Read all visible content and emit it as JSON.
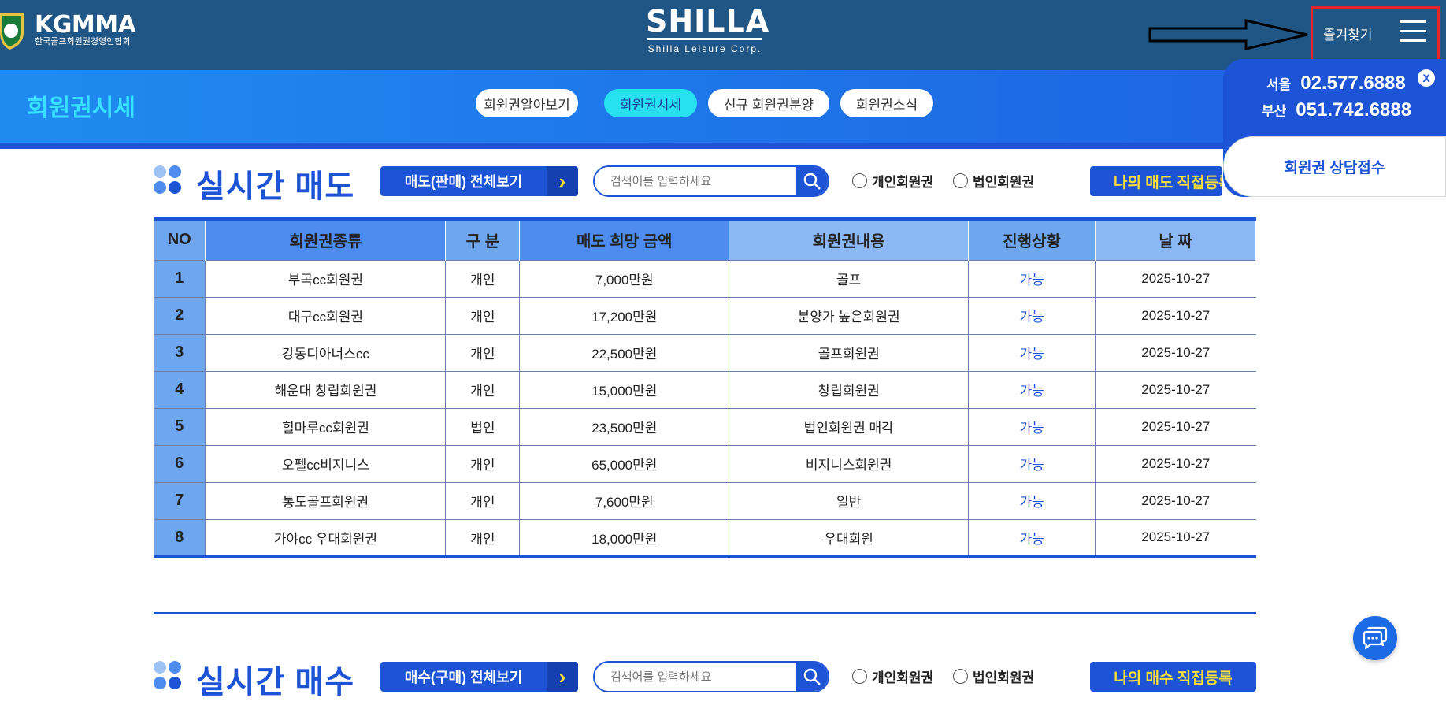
{
  "header": {
    "kgmma_logo_text": "KGMMA",
    "kgmma_logo_sub": "한국골프회원권경영인협회",
    "brand_name": "SHILLA",
    "brand_sub": "Shilla Leisure Corp.",
    "favorites_label": "즐겨찾기"
  },
  "subnav": {
    "title": "회원권시세",
    "tabs": [
      {
        "label": "회원권알아보기",
        "active": false
      },
      {
        "label": "회원권시세",
        "active": true
      },
      {
        "label": "신규 회원권분양",
        "active": false
      },
      {
        "label": "회원권소식",
        "active": false
      }
    ]
  },
  "contact": {
    "close_label": "X",
    "seoul_label": "서울",
    "seoul_phone": "02.577.6888",
    "busan_label": "부산",
    "busan_phone": "051.742.6888",
    "consult_label": "회원권 상담접수"
  },
  "sell_section": {
    "title": "실시간 매도",
    "view_all_label": "매도(판매) 전체보기",
    "search_placeholder": "검색어를 입력하세요",
    "radio_personal": "개인회원권",
    "radio_corporate": "법인회원권",
    "register_label": "나의 매도 직접등록"
  },
  "buy_section": {
    "title": "실시간 매수",
    "view_all_label": "매수(구매) 전체보기",
    "search_placeholder": "검색어를 입력하세요",
    "radio_personal": "개인회원권",
    "radio_corporate": "법인회원권",
    "register_label": "나의 매수 직접등록"
  },
  "table": {
    "headers": [
      "NO",
      "회원권종류",
      "구 분",
      "매도 희망 금액",
      "회원권내용",
      "진행상황",
      "날 짜"
    ],
    "rows": [
      [
        "1",
        "부곡cc회원권",
        "개인",
        "7,000만원",
        "골프",
        "가능",
        "2025-10-27"
      ],
      [
        "2",
        "대구cc회원권",
        "개인",
        "17,200만원",
        "분양가 높은회원권",
        "가능",
        "2025-10-27"
      ],
      [
        "3",
        "강동디아너스cc",
        "개인",
        "22,500만원",
        "골프회원권",
        "가능",
        "2025-10-27"
      ],
      [
        "4",
        "해운대 창립회원권",
        "개인",
        "15,000만원",
        "창립회원권",
        "가능",
        "2025-10-27"
      ],
      [
        "5",
        "힐마루cc회원권",
        "법인",
        "23,500만원",
        "법인회원권 매각",
        "가능",
        "2025-10-27"
      ],
      [
        "6",
        "오펠cc비지니스",
        "개인",
        "65,000만원",
        "비지니스회원권",
        "가능",
        "2025-10-27"
      ],
      [
        "7",
        "통도골프회원권",
        "개인",
        "7,600만원",
        "일반",
        "가능",
        "2025-10-27"
      ],
      [
        "8",
        "가야cc 우대회원권",
        "개인",
        "18,000만원",
        "우대회원",
        "가능",
        "2025-10-27"
      ]
    ]
  },
  "colors": {
    "header_bg": "#1f5685",
    "accent_blue": "#1d54d6",
    "cyan": "#27e0f0",
    "yellow": "#ffe034",
    "annotation_red": "#e3252b"
  },
  "icons": [
    "shield-logo-icon",
    "arrow-annotation-icon",
    "hamburger-menu-icon",
    "close-icon",
    "chevron-right-icon",
    "search-icon",
    "chat-icon"
  ]
}
